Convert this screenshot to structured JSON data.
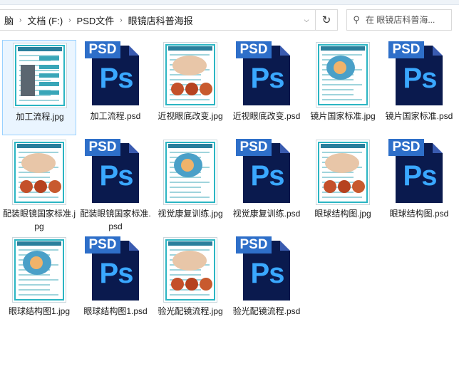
{
  "address_bar": {
    "breadcrumbs": [
      "脑",
      "文档 (F:)",
      "PSD文件",
      "眼镜店科普海报"
    ],
    "dropdown_icon": "chevron-down-icon",
    "refresh_icon": "refresh-icon"
  },
  "search": {
    "icon": "search-icon",
    "placeholder": "在 眼镜店科普海..."
  },
  "colors": {
    "selection_bg": "#eaf5ff",
    "selection_border": "#99d1ff",
    "psd_dark": "#0a1a4e",
    "psd_tag": "#2e6fc9",
    "psd_text": "#3aa8ff",
    "poster_accent": "#2bb5c3"
  },
  "files": [
    {
      "name": "加工流程.jpg",
      "type": "jpg",
      "selected": true
    },
    {
      "name": "加工流程.psd",
      "type": "psd"
    },
    {
      "name": "近视眼底改变.jpg",
      "type": "jpg"
    },
    {
      "name": "近视眼底改变.psd",
      "type": "psd"
    },
    {
      "name": "镜片国家标准.jpg",
      "type": "jpg"
    },
    {
      "name": "镜片国家标准.psd",
      "type": "psd"
    },
    {
      "name": "配装眼镜国家标准.jpg",
      "type": "jpg"
    },
    {
      "name": "配装眼镜国家标准.psd",
      "type": "psd"
    },
    {
      "name": "视觉康复训练.jpg",
      "type": "jpg"
    },
    {
      "name": "视觉康复训练.psd",
      "type": "psd"
    },
    {
      "name": "眼球结构图.jpg",
      "type": "jpg"
    },
    {
      "name": "眼球结构图.psd",
      "type": "psd"
    },
    {
      "name": "眼球结构图1.jpg",
      "type": "jpg"
    },
    {
      "name": "眼球结构图1.psd",
      "type": "psd"
    },
    {
      "name": "验光配镜流程.jpg",
      "type": "jpg"
    },
    {
      "name": "验光配镜流程.psd",
      "type": "psd"
    }
  ],
  "psd_icon": {
    "tag": "PSD",
    "mark": "Ps"
  }
}
